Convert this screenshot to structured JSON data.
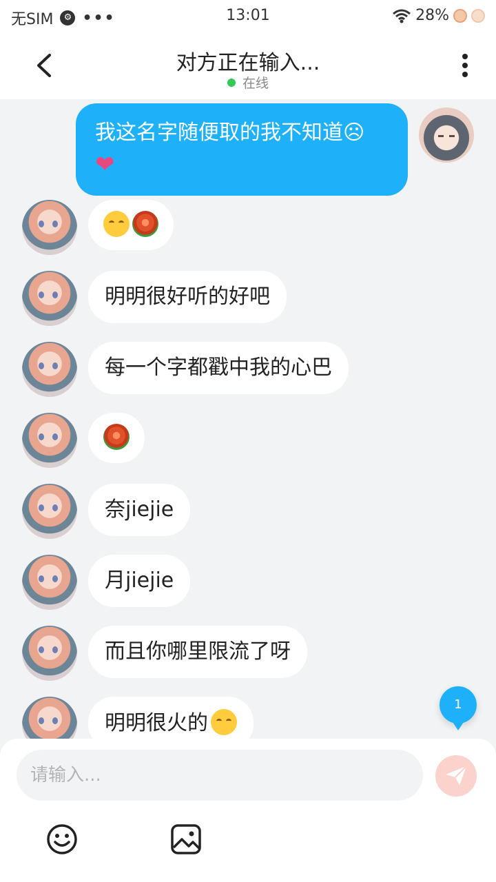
{
  "status_bar": {
    "carrier": "无SIM",
    "dots": "•••",
    "time": "13:01",
    "battery": "28%"
  },
  "header": {
    "title": "对方正在输入...",
    "status": "在线"
  },
  "messages": [
    {
      "side": "self",
      "text": "我这名字随便取的我不知道☹",
      "extra": "❤"
    },
    {
      "side": "other",
      "text": ""
    },
    {
      "side": "other",
      "text": "明明很好听的好吧"
    },
    {
      "side": "other",
      "text": "每一个字都戳中我的心巴"
    },
    {
      "side": "other",
      "text": ""
    },
    {
      "side": "other",
      "text": "奈jiejie"
    },
    {
      "side": "other",
      "text": "月jiejie"
    },
    {
      "side": "other",
      "text": "而且你哪里限流了呀"
    },
    {
      "side": "other",
      "text": "明明很火的"
    }
  ],
  "unread_count": "1",
  "composer": {
    "placeholder": "请输入..."
  },
  "icons": {
    "back": "back-arrow-icon",
    "more": "more-vertical-icon",
    "send": "send-icon",
    "emoji": "emoji-icon",
    "image": "image-icon"
  },
  "colors": {
    "self_bubble": "#1eb0f8",
    "online": "#34c759",
    "send_button": "#fbd2cc"
  }
}
